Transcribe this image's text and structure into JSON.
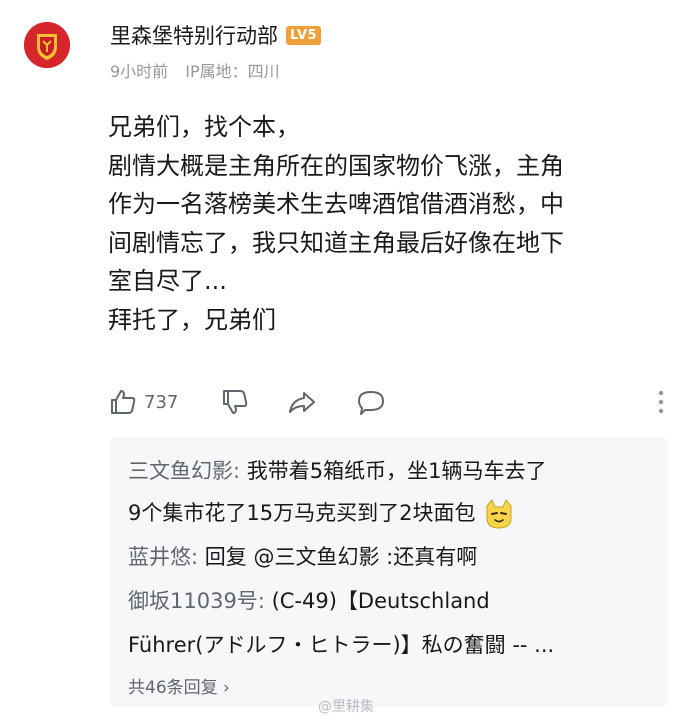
{
  "comment": {
    "username": "里森堡特别行动部",
    "level_badge": "LV5",
    "time": "9小时前",
    "ip_location": "IP属地：四川",
    "content_lines": [
      "兄弟们，找个本，",
      "剧情大概是主角所在的国家物价飞涨，主角",
      "作为一名落榜美术生去啤酒馆借酒消愁，中",
      "间剧情忘了，我只知道主角最后好像在地下",
      "室自尽了...",
      "拜托了，兄弟们"
    ],
    "like_count": "737"
  },
  "icons": {
    "like": "thumbs-up-icon",
    "dislike": "thumbs-down-icon",
    "share": "share-icon",
    "reply": "comment-icon",
    "more": "more-vertical-icon",
    "avatar": "avatar-emblem",
    "emoji": "cat-emoji-icon"
  },
  "replies": [
    {
      "name": "三文鱼幻影",
      "separator": ": ",
      "text": "我带着5箱纸币，坐1辆马车去了",
      "text_line2": "9个集市花了15万马克买到了2块面包"
    },
    {
      "name": "蓝井悠",
      "separator": ": ",
      "text": "回复 @三文鱼幻影 :还真有啊"
    },
    {
      "name": "御坂11039号",
      "separator": ": ",
      "text": "(C-49)【Deutschland",
      "text_line2": "Führer(アドルフ・ヒトラー)】私の奮闘 -- ..."
    }
  ],
  "total_replies": "共46条回复 ›",
  "watermark": "@里耕集",
  "colors": {
    "badge": "#f0a03a",
    "avatar_bg": "#d7262b",
    "secondary_text": "#9499a0",
    "reply_name": "#61666d",
    "reply_bg": "#f6f7f8"
  }
}
